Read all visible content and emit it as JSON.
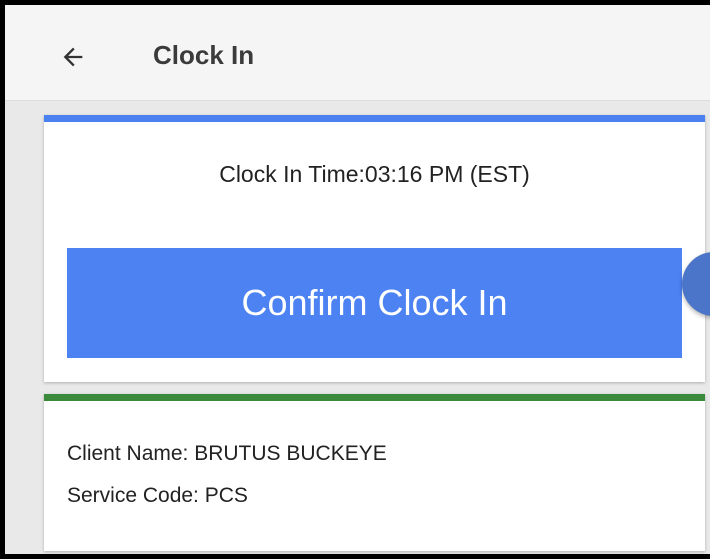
{
  "app_bar": {
    "title": "Clock In",
    "back_icon": "arrow-left-icon"
  },
  "clock_card": {
    "accent_color": "#4a80f0",
    "time_text": "Clock In Time:03:16 PM (EST)",
    "confirm_label": "Confirm Clock In",
    "button_color": "#4d82f3"
  },
  "client_card": {
    "accent_color": "#3b8a3b",
    "client_name": "Client Name: BRUTUS BUCKEYE",
    "service_code": "Service Code: PCS"
  }
}
